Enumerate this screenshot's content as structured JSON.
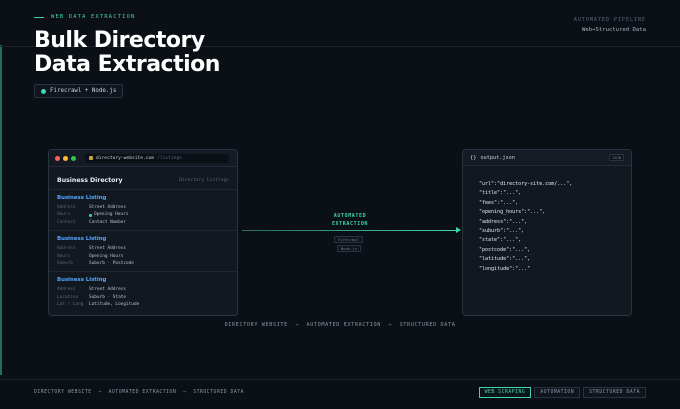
{
  "header": {
    "eyebrow": "WEB DATA EXTRACTION",
    "title_line1": "Bulk Directory",
    "title_line2": "Data Extraction",
    "tech_badge": "Firecrawl + Node.js",
    "pipeline_label": "AUTOMATED PIPELINE",
    "pipeline_sub": "Web→Structured Data"
  },
  "browser": {
    "host": "directory-website.com",
    "path": "/listings",
    "heading": "Business Directory",
    "subheading": "Directory Listings",
    "listings": [
      {
        "title": "Business Listing",
        "rows": [
          {
            "k": "Address",
            "v": "Street Address"
          },
          {
            "k": "Hours",
            "v": "Opening Hours",
            "indicator": true
          },
          {
            "k": "Contact",
            "v": "Contact Number"
          }
        ]
      },
      {
        "title": "Business Listing",
        "rows": [
          {
            "k": "Address",
            "v": "Street Address"
          },
          {
            "k": "Hours",
            "v": "Opening Hours"
          },
          {
            "k": "Suburb",
            "v": "Suburb · Postcode"
          }
        ]
      },
      {
        "title": "Business Listing",
        "rows": [
          {
            "k": "Address",
            "v": "Street Address"
          },
          {
            "k": "Location",
            "v": "Suburb · State"
          },
          {
            "k": "Lat / Long",
            "v": "Latitude, Longitude"
          }
        ]
      }
    ]
  },
  "flow": {
    "label_line1": "AUTOMATED",
    "label_line2": "EXTRACTION",
    "chip1": "Firecrawl",
    "chip2": "Node.js"
  },
  "json_panel": {
    "filename": "output.json",
    "tag": "JSON",
    "lines": [
      "\"url\":\"directory-site.com/...\",",
      "\"title\":\"...\",",
      "\"fees\":\"...\",",
      "\"opening_hours\":\"...\",",
      "\"address\":\"...\",",
      "\"suburb\":\"...\",",
      "\"state\":\"...\",",
      "\"postcode\":\"...\",",
      "\"latitude\":\"...\",",
      "\"longitude\":\"...\""
    ]
  },
  "caption": "DIRECTORY WEBSITE  →  AUTOMATED EXTRACTION  →  STRUCTURED DATA",
  "footer": {
    "left": "DIRECTORY WEBSITE  →  AUTOMATED EXTRACTION  →  STRUCTURED DATA",
    "tags": [
      "WEB SCRAPING",
      "AUTOMATION",
      "STRUCTURED DATA"
    ],
    "active_tag_index": 0
  },
  "colors": {
    "accent": "#3fd6a8",
    "link": "#58a6ff",
    "traffic_red": "#ff5f57",
    "traffic_yellow": "#febc2e",
    "traffic_green": "#28c840"
  }
}
